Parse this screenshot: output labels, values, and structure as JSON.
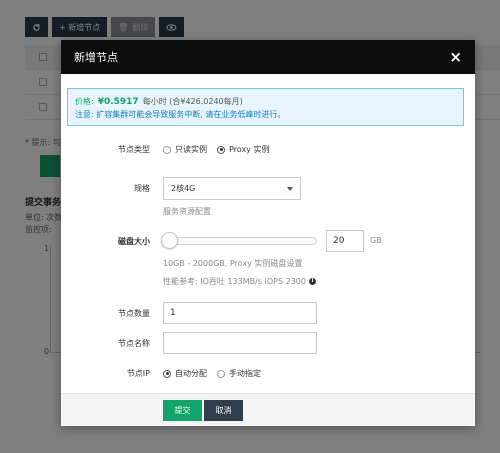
{
  "background": {
    "toolbar": {
      "refresh_icon": "refresh-icon",
      "add_node_label": "+ 新增节点",
      "delete_label": "删除",
      "eye_icon": "eye-icon"
    },
    "tip_text": "* 提示: 可",
    "section_title": "提交事务",
    "line1": "单位: 次数",
    "line2": "监控项:",
    "chart_y_top": "1",
    "chart_y_bottom": "0"
  },
  "modal": {
    "title": "新增节点",
    "close_symbol": "×",
    "alert": {
      "price_label": "价格:",
      "price_value": "¥0.5917",
      "price_unit": "每小时 (合¥426.0240每月)",
      "notice": "注意: 扩容集群可能会导致服务中断, 请在业务低峰时进行。"
    },
    "node_type": {
      "label": "节点类型",
      "options": [
        "只读实例",
        "Proxy 实例"
      ],
      "selected": "Proxy 实例"
    },
    "spec": {
      "label": "规格",
      "value": "2核4G",
      "hint": "服务资源配置"
    },
    "disk": {
      "label": "磁盘大小",
      "value": "20",
      "unit": "GB",
      "range_hint": "10GB - 2000GB, Proxy 实例磁盘设置",
      "perf_hint": "性能参考: IO吞吐 133MB/s  IOPS 2300"
    },
    "node_count": {
      "label": "节点数量",
      "value": "1"
    },
    "node_name": {
      "label": "节点名称",
      "value": ""
    },
    "node_ip": {
      "label": "节点IP",
      "options": [
        "自动分配",
        "手动指定"
      ],
      "selected": "自动分配"
    },
    "footer": {
      "submit_label": "提交",
      "cancel_label": "取消"
    }
  }
}
